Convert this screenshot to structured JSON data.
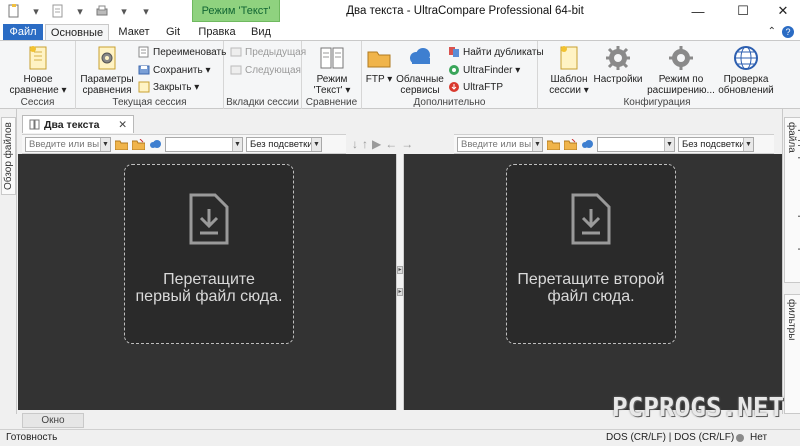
{
  "titlebar": {
    "mode_label": "Режим 'Текст'",
    "title": "Два текста - UltraCompare Professional 64-bit",
    "minimize": "—",
    "maximize": "☐",
    "close": "✕"
  },
  "tabs": [
    {
      "label": "Файл"
    },
    {
      "label": "Основные"
    },
    {
      "label": "Макет"
    },
    {
      "label": "Git"
    },
    {
      "label": "Правка"
    },
    {
      "label": "Вид"
    }
  ],
  "tabrow_right": {
    "collapse": "⌃"
  },
  "ribbon": {
    "session": {
      "label": "Сессия",
      "new_compare": "Новое сравнение ▾"
    },
    "current_session": {
      "label": "Текущая сессия",
      "params": "Параметры сравнения",
      "rename": "Переименовать",
      "save": "Сохранить ▾",
      "close": "Закрыть ▾"
    },
    "session_tabs": {
      "label": "Вкладки сессии",
      "prev": "Предыдущая",
      "next": "Следующая"
    },
    "compare": {
      "label": "Сравнение",
      "mode": "Режим 'Текст' ▾"
    },
    "extra": {
      "label": "Дополнительно",
      "ftp": "FTP ▾",
      "cloud": "Облачные сервисы",
      "find_dupes": "Найти дубликаты",
      "ultrafinder": "UltraFinder ▾",
      "ultraftp": "UltraFTP"
    },
    "config": {
      "label": "Конфигурация",
      "template": "Шаблон сессии ▾",
      "settings": "Настройки",
      "default_mode": "Режим по расширению...",
      "updates": "Проверка обновлений"
    }
  },
  "left_strip": {
    "file_browser": "Обзор файлов"
  },
  "right_strip": {
    "preview": "Предварительный просмотр файла",
    "markers": "Обозначения и фильтры"
  },
  "doc": {
    "tab_title": "Два текста",
    "tab_close": "✕"
  },
  "left_pane": {
    "input_placeholder": "Введите или вы",
    "highlight": "Без подсветки",
    "drop_text": "Перетащите первый файл сюда."
  },
  "right_pane": {
    "input_placeholder": "Введите или вы",
    "highlight": "Без подсветки",
    "drop_text": "Перетащите второй файл сюда."
  },
  "output_tab": "Окно вывода",
  "status": {
    "ready": "Готовность",
    "line_endings": "DOS (CR/LF) | DOS (CR/LF)",
    "state": "Нет"
  },
  "watermark": "PCPROGS.NET",
  "colors": {
    "file_tab": "#2b6cc4",
    "mode_tab": "#8fd27f",
    "pane_bg": "#333333"
  }
}
